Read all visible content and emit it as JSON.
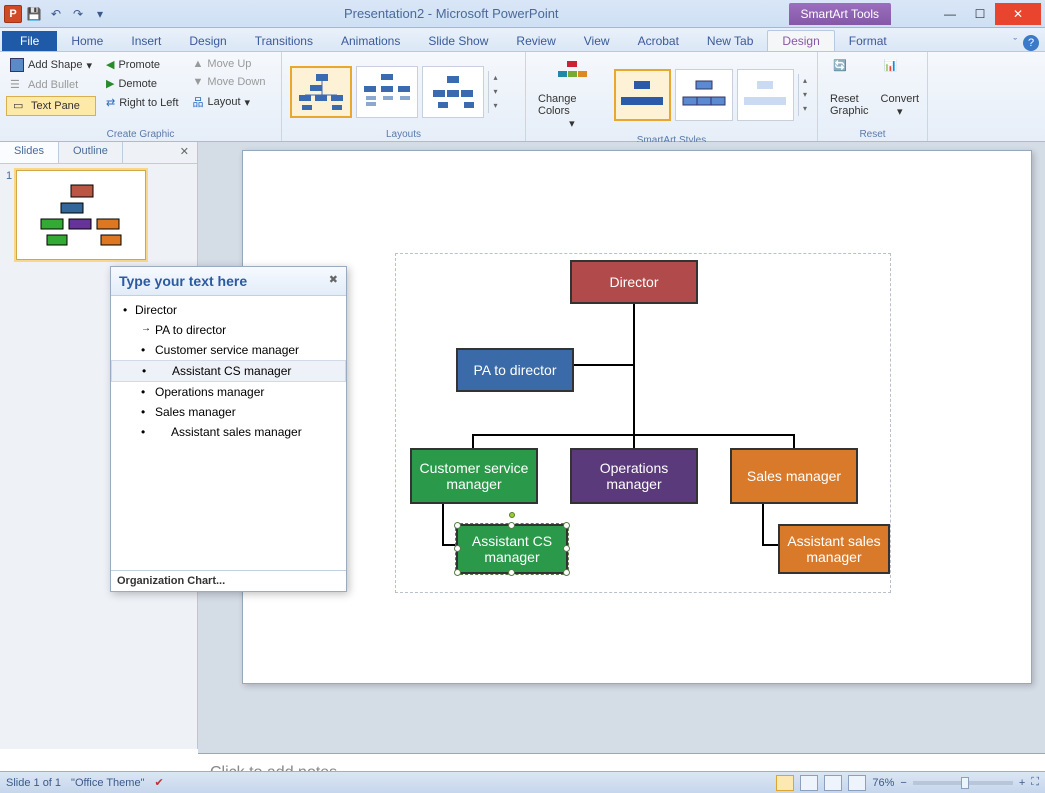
{
  "app": {
    "title": "Presentation2 - Microsoft PowerPoint",
    "tool_context": "SmartArt Tools"
  },
  "tabs": {
    "file": "File",
    "home": "Home",
    "insert": "Insert",
    "design": "Design",
    "transitions": "Transitions",
    "animations": "Animations",
    "slideshow": "Slide Show",
    "review": "Review",
    "view": "View",
    "acrobat": "Acrobat",
    "newtab": "New Tab",
    "sa_design": "Design",
    "sa_format": "Format"
  },
  "ribbon": {
    "create_graphic": {
      "label": "Create Graphic",
      "add_shape": "Add Shape",
      "add_bullet": "Add Bullet",
      "text_pane": "Text Pane",
      "promote": "Promote",
      "demote": "Demote",
      "rtl": "Right to Left",
      "move_up": "Move Up",
      "move_down": "Move Down",
      "layout": "Layout"
    },
    "layouts": {
      "label": "Layouts"
    },
    "styles": {
      "label": "SmartArt Styles",
      "change_colors": "Change Colors"
    },
    "reset": {
      "label": "Reset",
      "reset_graphic": "Reset Graphic",
      "convert": "Convert"
    }
  },
  "slides_pane": {
    "tab_slides": "Slides",
    "tab_outline": "Outline",
    "slide_num": "1"
  },
  "textpane": {
    "title": "Type your text here",
    "items": {
      "director": "Director",
      "pa": "PA to director",
      "csm": "Customer service manager",
      "acsm": "Assistant CS manager",
      "ops": "Operations manager",
      "sales": "Sales manager",
      "asm": "Assistant sales manager"
    },
    "footer": "Organization Chart..."
  },
  "org": {
    "director": "Director",
    "pa": "PA to director",
    "csm": "Customer service manager",
    "ops": "Operations manager",
    "sales": "Sales manager",
    "acsm": "Assistant CS manager",
    "asm": "Assistant sales manager"
  },
  "notes": {
    "placeholder": "Click to add notes"
  },
  "status": {
    "slide": "Slide 1 of 1",
    "theme": "\"Office Theme\"",
    "zoom": "76%"
  }
}
